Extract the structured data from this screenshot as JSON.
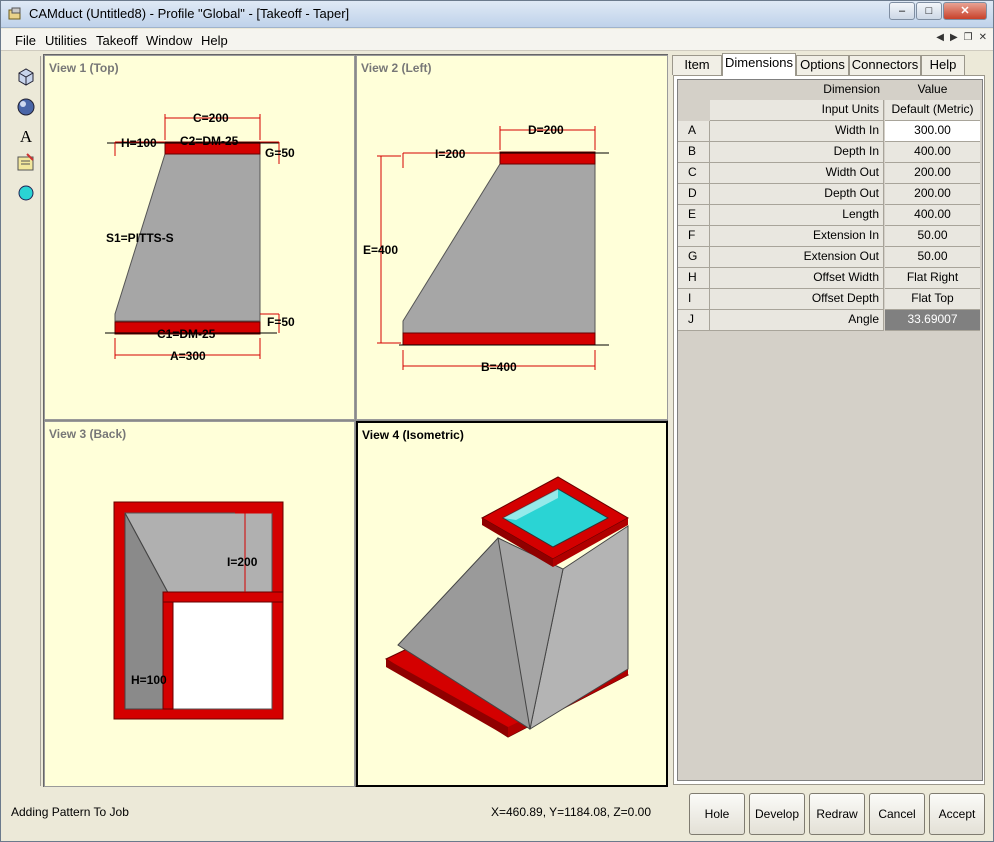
{
  "window": {
    "title": "CAMduct (Untitled8) - Profile \"Global\" - [Takeoff - Taper]"
  },
  "menu": {
    "items": [
      "File",
      "Utilities",
      "Takeoff",
      "Window",
      "Help"
    ]
  },
  "views": {
    "v1": {
      "label": "View 1 (Top)",
      "dims": {
        "c": "C=200",
        "h": "H=100",
        "c2": "C2=DM-25",
        "g": "G=50",
        "s1": "S1=PITTS-S",
        "f": "F=50",
        "c1": "C1=DM-25",
        "a": "A=300"
      }
    },
    "v2": {
      "label": "View 2 (Left)",
      "dims": {
        "d": "D=200",
        "i": "I=200",
        "e": "E=400",
        "b": "B=400"
      }
    },
    "v3": {
      "label": "View 3 (Back)",
      "dims": {
        "i": "I=200",
        "h": "H=100"
      }
    },
    "v4": {
      "label": "View 4 (Isometric)"
    }
  },
  "panel": {
    "tabs": [
      "Item",
      "Dimensions",
      "Options",
      "Connectors",
      "Help"
    ],
    "active_tab": "Dimensions",
    "header": {
      "dimension": "Dimension",
      "value": "Value"
    },
    "input_units": {
      "label": "Input Units",
      "value": "Default (Metric)"
    },
    "rows": [
      {
        "letter": "A",
        "name": "Width In",
        "value": "300.00"
      },
      {
        "letter": "B",
        "name": "Depth In",
        "value": "400.00"
      },
      {
        "letter": "C",
        "name": "Width Out",
        "value": "200.00"
      },
      {
        "letter": "D",
        "name": "Depth Out",
        "value": "200.00"
      },
      {
        "letter": "E",
        "name": "Length",
        "value": "400.00"
      },
      {
        "letter": "F",
        "name": "Extension In",
        "value": "50.00"
      },
      {
        "letter": "G",
        "name": "Extension Out",
        "value": "50.00"
      },
      {
        "letter": "H",
        "name": "Offset Width",
        "value": "Flat Right"
      },
      {
        "letter": "I",
        "name": "Offset Depth",
        "value": "Flat Top"
      },
      {
        "letter": "J",
        "name": "Angle",
        "value": "33.69007"
      }
    ]
  },
  "status": {
    "message": "Adding Pattern To Job",
    "coords": "X=460.89, Y=1184.08, Z=0.00"
  },
  "buttons": {
    "hole": "Hole",
    "develop": "Develop",
    "redraw": "Redraw",
    "cancel": "Cancel",
    "accept": "Accept"
  },
  "colors": {
    "duct_gray": "#a6a6a6",
    "connector_red": "#d40000",
    "view_bg": "#ffffd9",
    "cyan_face": "#2ad4d4"
  }
}
